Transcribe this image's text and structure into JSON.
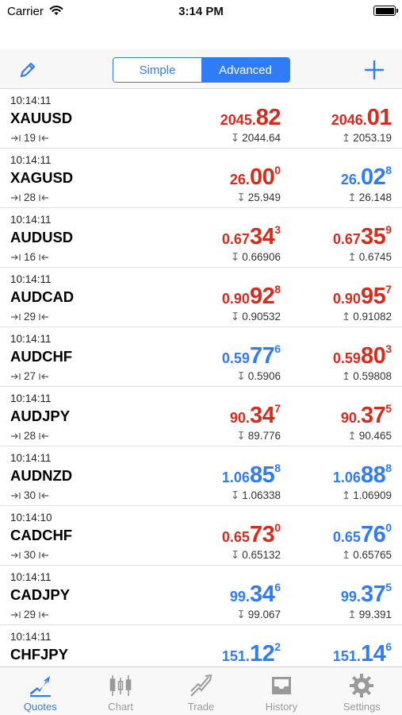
{
  "status_bar": {
    "carrier": "Carrier",
    "time": "3:14 PM"
  },
  "toolbar": {
    "segments": [
      "Simple",
      "Advanced"
    ],
    "selected": "Advanced"
  },
  "colors": {
    "accent": "#2f7cf6",
    "down": "#d92a1c",
    "up": "#2f7cf6"
  },
  "quotes": [
    {
      "time": "10:14:11",
      "symbol": "XAUUSD",
      "spread": "19",
      "bid": {
        "small": "2045.",
        "big": "82",
        "sup": "",
        "color": "red"
      },
      "ask": {
        "small": "2046.",
        "big": "01",
        "sup": "",
        "color": "red"
      },
      "low": "2044.64",
      "high": "2053.19"
    },
    {
      "time": "10:14:11",
      "symbol": "XAGUSD",
      "spread": "28",
      "bid": {
        "small": "26.",
        "big": "00",
        "sup": "0",
        "color": "red"
      },
      "ask": {
        "small": "26.",
        "big": "02",
        "sup": "8",
        "color": "blue"
      },
      "low": "25.949",
      "high": "26.148"
    },
    {
      "time": "10:14:11",
      "symbol": "AUDUSD",
      "spread": "16",
      "bid": {
        "small": "0.67",
        "big": "34",
        "sup": "3",
        "color": "red"
      },
      "ask": {
        "small": "0.67",
        "big": "35",
        "sup": "9",
        "color": "red"
      },
      "low": "0.66906",
      "high": "0.6745"
    },
    {
      "time": "10:14:11",
      "symbol": "AUDCAD",
      "spread": "29",
      "bid": {
        "small": "0.90",
        "big": "92",
        "sup": "8",
        "color": "red"
      },
      "ask": {
        "small": "0.90",
        "big": "95",
        "sup": "7",
        "color": "red"
      },
      "low": "0.90532",
      "high": "0.91082"
    },
    {
      "time": "10:14:11",
      "symbol": "AUDCHF",
      "spread": "27",
      "bid": {
        "small": "0.59",
        "big": "77",
        "sup": "6",
        "color": "blue"
      },
      "ask": {
        "small": "0.59",
        "big": "80",
        "sup": "3",
        "color": "red"
      },
      "low": "0.5906",
      "high": "0.59808"
    },
    {
      "time": "10:14:11",
      "symbol": "AUDJPY",
      "spread": "28",
      "bid": {
        "small": "90.",
        "big": "34",
        "sup": "7",
        "color": "red"
      },
      "ask": {
        "small": "90.",
        "big": "37",
        "sup": "5",
        "color": "red"
      },
      "low": "89.776",
      "high": "90.465"
    },
    {
      "time": "10:14:11",
      "symbol": "AUDNZD",
      "spread": "30",
      "bid": {
        "small": "1.06",
        "big": "85",
        "sup": "8",
        "color": "blue"
      },
      "ask": {
        "small": "1.06",
        "big": "88",
        "sup": "8",
        "color": "blue"
      },
      "low": "1.06338",
      "high": "1.06909"
    },
    {
      "time": "10:14:10",
      "symbol": "CADCHF",
      "spread": "30",
      "bid": {
        "small": "0.65",
        "big": "73",
        "sup": "0",
        "color": "red"
      },
      "ask": {
        "small": "0.65",
        "big": "76",
        "sup": "0",
        "color": "blue"
      },
      "low": "0.65132",
      "high": "0.65765"
    },
    {
      "time": "10:14:11",
      "symbol": "CADJPY",
      "spread": "29",
      "bid": {
        "small": "99.",
        "big": "34",
        "sup": "6",
        "color": "blue"
      },
      "ask": {
        "small": "99.",
        "big": "37",
        "sup": "5",
        "color": "blue"
      },
      "low": "99.067",
      "high": "99.391"
    },
    {
      "time": "10:14:11",
      "symbol": "CHFJPY",
      "spread": "",
      "bid": {
        "small": "151.",
        "big": "12",
        "sup": "2",
        "color": "blue"
      },
      "ask": {
        "small": "151.",
        "big": "14",
        "sup": "6",
        "color": "blue"
      },
      "low": "",
      "high": ""
    }
  ],
  "tabs": [
    {
      "label": "Quotes",
      "icon": "quotes-icon",
      "active": true
    },
    {
      "label": "Chart",
      "icon": "chart-icon",
      "active": false
    },
    {
      "label": "Trade",
      "icon": "trade-icon",
      "active": false
    },
    {
      "label": "History",
      "icon": "history-icon",
      "active": false
    },
    {
      "label": "Settings",
      "icon": "gear-icon",
      "active": false
    }
  ]
}
